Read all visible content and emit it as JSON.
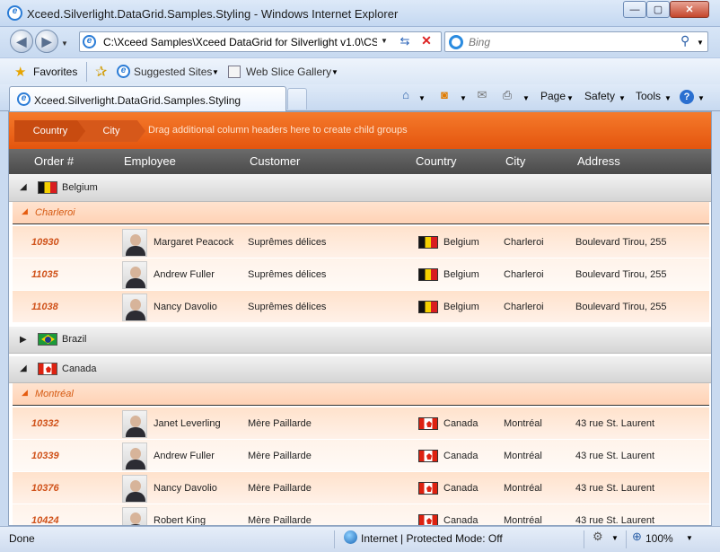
{
  "window": {
    "title": "Xceed.Silverlight.DataGrid.Samples.Styling - Windows Internet Explorer",
    "min": "—",
    "max": "▢",
    "close": "✕"
  },
  "address": {
    "url": "C:\\Xceed Samples\\Xceed DataGrid for Silverlight v1.0\\CSh",
    "search_placeholder": "Bing"
  },
  "favorites": {
    "label": "Favorites",
    "suggested": "Suggested Sites",
    "webslice": "Web Slice Gallery"
  },
  "tab": {
    "label": "Xceed.Silverlight.DataGrid.Samples.Styling"
  },
  "toolbar": {
    "page": "Page",
    "safety": "Safety",
    "tools": "Tools"
  },
  "grid": {
    "group_chips": [
      "Country",
      "City"
    ],
    "group_hint": "Drag additional column headers here to create child groups",
    "columns": [
      "Order #",
      "Employee",
      "Customer",
      "Country",
      "City",
      "Address"
    ],
    "groups": [
      {
        "country": "Belgium",
        "flag": "be",
        "expanded": true,
        "subgroup": "Charleroi",
        "rows": [
          {
            "order": "10930",
            "employee": "Margaret Peacock",
            "customer": "Suprêmes délices",
            "country": "Belgium",
            "city": "Charleroi",
            "address": "Boulevard Tirou, 255"
          },
          {
            "order": "11035",
            "employee": "Andrew Fuller",
            "customer": "Suprêmes délices",
            "country": "Belgium",
            "city": "Charleroi",
            "address": "Boulevard Tirou, 255"
          },
          {
            "order": "11038",
            "employee": "Nancy Davolio",
            "customer": "Suprêmes délices",
            "country": "Belgium",
            "city": "Charleroi",
            "address": "Boulevard Tirou, 255"
          }
        ]
      },
      {
        "country": "Brazil",
        "flag": "br",
        "expanded": false
      },
      {
        "country": "Canada",
        "flag": "ca",
        "expanded": true,
        "subgroup": "Montréal",
        "rows": [
          {
            "order": "10332",
            "employee": "Janet Leverling",
            "customer": "Mère Paillarde",
            "country": "Canada",
            "city": "Montréal",
            "address": "43 rue St. Laurent"
          },
          {
            "order": "10339",
            "employee": "Andrew Fuller",
            "customer": "Mère Paillarde",
            "country": "Canada",
            "city": "Montréal",
            "address": "43 rue St. Laurent"
          },
          {
            "order": "10376",
            "employee": "Nancy Davolio",
            "customer": "Mère Paillarde",
            "country": "Canada",
            "city": "Montréal",
            "address": "43 rue St. Laurent"
          },
          {
            "order": "10424",
            "employee": "Robert King",
            "customer": "Mère Paillarde",
            "country": "Canada",
            "city": "Montréal",
            "address": "43 rue St. Laurent"
          }
        ]
      }
    ]
  },
  "status": {
    "text": "Done",
    "zone": "Internet | Protected Mode: Off",
    "zoom": "100%"
  },
  "colors": {
    "accent": "#e4550e",
    "order_text": "#d0521a",
    "header_bg": "#4a4a4a"
  },
  "icons": {
    "back": "back-arrow-icon",
    "forward": "forward-arrow-icon",
    "refresh": "refresh-icon",
    "stop": "stop-icon",
    "search": "search-icon",
    "home": "home-icon",
    "feeds": "rss-icon",
    "mail": "mail-icon",
    "print": "print-icon",
    "help": "help-icon"
  }
}
